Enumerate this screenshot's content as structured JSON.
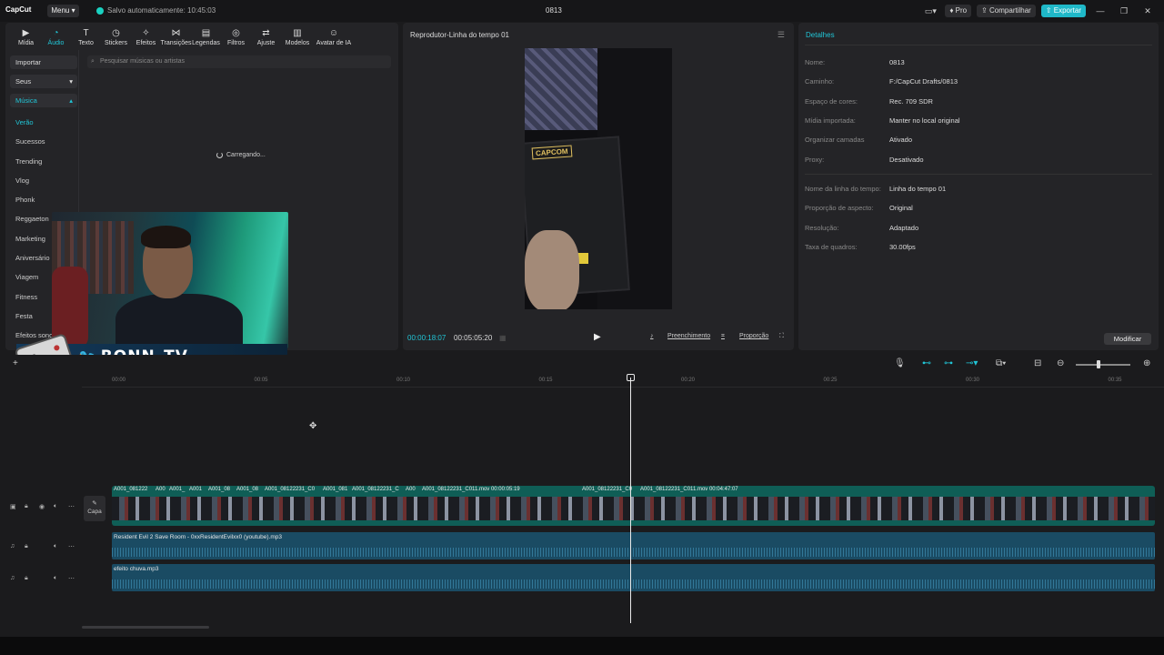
{
  "topbar": {
    "logo": "CapCut",
    "menu_label": "Menu",
    "autosave": "Salvo automaticamente: 10:45:03",
    "project_title": "0813",
    "pro_label": "Pro",
    "share_label": "Compartilhar",
    "export_label": "Exportar"
  },
  "media_tabs": [
    {
      "label": "Mídia",
      "icon": "media-icon"
    },
    {
      "label": "Áudio",
      "icon": "audio-icon"
    },
    {
      "label": "Texto",
      "icon": "text-icon"
    },
    {
      "label": "Stickers",
      "icon": "sticker-icon"
    },
    {
      "label": "Efeitos",
      "icon": "effects-icon"
    },
    {
      "label": "Transições",
      "icon": "transitions-icon"
    },
    {
      "label": "Legendas",
      "icon": "captions-icon"
    },
    {
      "label": "Filtros",
      "icon": "filters-icon"
    },
    {
      "label": "Ajuste",
      "icon": "adjust-icon"
    },
    {
      "label": "Modelos",
      "icon": "templates-icon"
    },
    {
      "label": "Avatar de IA",
      "icon": "ai-avatar-icon"
    }
  ],
  "sidebar": {
    "import_label": "Importar",
    "yours_label": "Seus",
    "music_label": "Música",
    "items": [
      "Verão",
      "Sucessos",
      "Trending",
      "Vlog",
      "Phonk",
      "Reggaeton",
      "Marketing",
      "Aniversário",
      "Viagem",
      "Fitness",
      "Festa",
      "Efeitos sonoros"
    ]
  },
  "search": {
    "placeholder": "Pesquisar músicas ou artistas"
  },
  "loading_text": "Carregando...",
  "overlay": {
    "channel": "RONN_TV"
  },
  "player": {
    "title": "Reprodutor-Linha do tempo 01",
    "current_time": "00:00:18:07",
    "total_time": "00:05:05:20",
    "fill_label": "Preenchimento",
    "ratio_label": "Proporção",
    "video_label": "CAPCOM"
  },
  "details": {
    "title": "Detalhes",
    "rows": [
      {
        "label": "Nome:",
        "value": "0813"
      },
      {
        "label": "Caminho:",
        "value": "F:/CapCut Drafts/0813"
      },
      {
        "label": "Espaço de cores:",
        "value": "Rec. 709 SDR"
      },
      {
        "label": "Mídia importada:",
        "value": "Manter no local original"
      },
      {
        "label": "Organizar camadas",
        "value": "Ativado"
      },
      {
        "label": "Proxy:",
        "value": "Desativado"
      }
    ],
    "rows2": [
      {
        "label": "Nome da linha do tempo:",
        "value": "Linha do tempo 01"
      },
      {
        "label": "Proporção de aspecto:",
        "value": "Original"
      },
      {
        "label": "Resolução:",
        "value": "Adaptado"
      },
      {
        "label": "Taxa de quadros:",
        "value": "30.00fps"
      }
    ],
    "modify_label": "Modificar"
  },
  "timeline": {
    "ticks": [
      "00:00",
      "00:05",
      "00:10",
      "00:15",
      "00:20",
      "00:25",
      "00:30",
      "00:35"
    ],
    "cover_label": "Capa",
    "clips": [
      {
        "label": "A001_081222"
      },
      {
        "label": "A00"
      },
      {
        "label": "A001_"
      },
      {
        "label": "A001"
      },
      {
        "label": "A001_08"
      },
      {
        "label": "A001_08"
      },
      {
        "label": "A001_08122231_C0"
      },
      {
        "label": "A001_081"
      },
      {
        "label": "A001_08122231_C"
      },
      {
        "label": "A00"
      },
      {
        "label": "A001_08122231_C011.mov   00:00:05:19"
      },
      {
        "label": "A001_08122231_C0"
      },
      {
        "label": "A001_08122231_C011.mov   00:04:47:07"
      }
    ],
    "audio1": "Resident Evil 2 Save Room - 0xxResidentEvilxx0 (youtube).mp3",
    "audio2": "efeito chuva.mp3"
  }
}
